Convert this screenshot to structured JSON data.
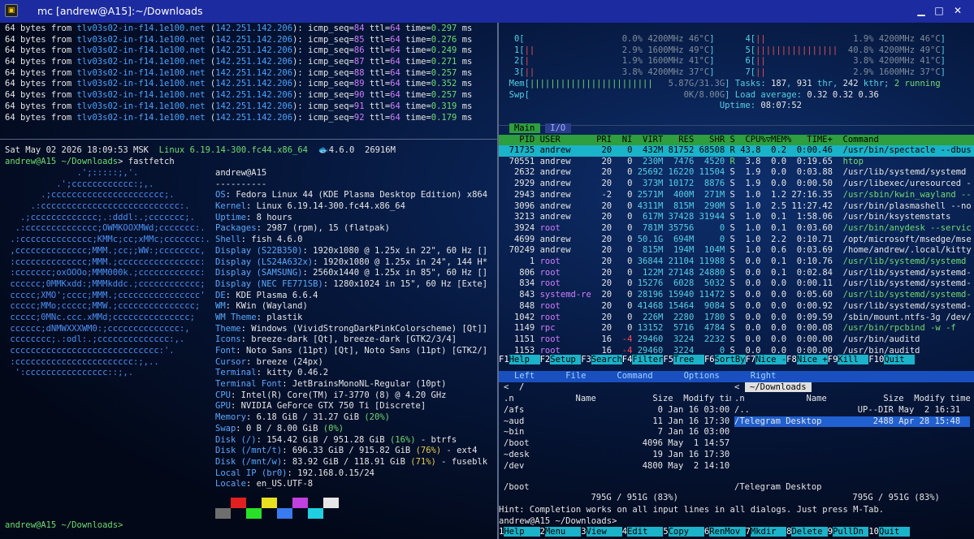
{
  "window": {
    "title": "mc [andrew@A15]:~/Downloads"
  },
  "ping": [
    {
      "seq": "84",
      "time": "0.297"
    },
    {
      "seq": "85",
      "time": "0.276"
    },
    {
      "seq": "86",
      "time": "0.249"
    },
    {
      "seq": "87",
      "time": "0.271"
    },
    {
      "seq": "88",
      "time": "0.257"
    },
    {
      "seq": "89",
      "time": "0.352"
    },
    {
      "seq": "90",
      "time": "0.257"
    },
    {
      "seq": "91",
      "time": "0.319"
    },
    {
      "seq": "92",
      "time": "0.179"
    }
  ],
  "ping_host": "tlv03s02-in-f14.1e100.net",
  "ping_ip": "142.251.142.206",
  "status": {
    "date": "Sat May 02 2026 18:09:53 MSK",
    "kernel": "Linux 6.19.14-300.fc44.x86_64",
    "shell_ver": "4.6.0",
    "mem": "26916M"
  },
  "prompt": {
    "user": "andrew@A15",
    "dir": "~/Downloads",
    "cmd": "fastfetch"
  },
  "logo": [
    "              .';:::::;,'.",
    "          .';cccccccccccc:;,.",
    "       .;cccccccccccccccccccccc;.",
    "     .:ccccccccccccccccccccccccccc:.",
    "   .;ccccccccccccc;.:dddl:.;ccccccc;.",
    "  .:cccccccccccccc;OWMKOOXMWd;ccccccc:.",
    " .:cccccccccccccc;KMMc;cc;xMMc;ccccccc:.",
    " ,cccccccccccccc;MMM.;cc;;WW:;cccccccc,",
    " :cccccccccccccc;MMM.;cccccccccccccccc:",
    " :ccccccc;oxOOOo;MMM000k.;cccccccccccc:",
    " cccccc;0MMKxdd:;MMMkddc.;cccccccccccc;",
    " ccccc;XMO';cccc;MMM.;cccccccccccccccc'",
    " ccccc;MMo;ccccc;MMW.;ccccccccccccccc;",
    " ccccc;0MNc.ccc.xMMd;ccccccccccccccc;",
    " cccccc;dNMWXXXWM0:;cccccccccccccc:,",
    " cccccccc;.:odl:.;cccccccccccccc:,.",
    " ccccccccccccccccccccccccccccc:'.",
    " :ccccccccccccccccccccccc:;,..",
    "  ':cccccccccccccccc::;,."
  ],
  "ff_user": "andrew@A15",
  "ff_sep": "----------",
  "ff": [
    {
      "k": "OS",
      "v": "Fedora Linux 44 (KDE Plasma Desktop Edition) x864"
    },
    {
      "k": "Kernel",
      "v": "Linux 6.19.14-300.fc44.x86_64"
    },
    {
      "k": "Uptime",
      "v": "8 hours"
    },
    {
      "k": "Packages",
      "v": "2987 (rpm), 15 (flatpak)"
    },
    {
      "k": "Shell",
      "v": "fish 4.6.0"
    },
    {
      "k": "Display (S22B350)",
      "v": "1920x1080 @ 1.25x in 22\", 60 Hz []"
    },
    {
      "k": "Display (LS24A632x)",
      "v": "1920x1080 @ 1.25x in 24\", 144 H*"
    },
    {
      "k": "Display (SAMSUNG)",
      "v": "2560x1440 @ 1.25x in 85\", 60 Hz []"
    },
    {
      "k": "Display (NEC FE771SB)",
      "v": "1280x1024 in 15\", 60 Hz [Exte]"
    },
    {
      "k": "DE",
      "v": "KDE Plasma 6.6.4"
    },
    {
      "k": "WM",
      "v": "KWin (Wayland)"
    },
    {
      "k": "WM Theme",
      "v": "plastik"
    },
    {
      "k": "Theme",
      "v": "Windows (VividStrongDarkPinkColorscheme) [Qt]]"
    },
    {
      "k": "Icons",
      "v": "breeze-dark [Qt], breeze-dark [GTK2/3/4]"
    },
    {
      "k": "Font",
      "v": "Noto Sans (11pt) [Qt], Noto Sans (11pt) [GTK2/]"
    },
    {
      "k": "Cursor",
      "v": "breeze (24px)"
    },
    {
      "k": "Terminal",
      "v": "kitty 0.46.2"
    },
    {
      "k": "Terminal Font",
      "v": "JetBrainsMonoNL-Regular (10pt)"
    },
    {
      "k": "CPU",
      "v": "Intel(R) Core(TM) i7-3770 (8) @ 4.20 GHz"
    },
    {
      "k": "GPU",
      "v": "NVIDIA GeForce GTX 750 Ti [Discrete]"
    },
    {
      "k": "Memory",
      "v": "6.18 GiB / 31.27 GiB",
      "p": "(20%)",
      "pc": "g"
    },
    {
      "k": "Swap",
      "v": "0 B / 8.00 GiB",
      "p": "(0%)",
      "pc": "g"
    },
    {
      "k": "Disk (/)",
      "v": "154.42 GiB / 951.28 GiB",
      "p": "(16%)",
      "pc": "g",
      "t": " - btrfs"
    },
    {
      "k": "Disk (/mnt/t)",
      "v": "696.33 GiB / 915.82 GiB",
      "p": "(76%)",
      "pc": "y",
      "t": " - ext4"
    },
    {
      "k": "Disk (/mnt/w)",
      "v": "83.92 GiB / 118.91 GiB",
      "p": "(71%)",
      "pc": "y",
      "t": " - fuseblk"
    },
    {
      "k": "Local IP (br0)",
      "v": "192.168.0.15/24"
    },
    {
      "k": "Locale",
      "v": "en_US.UTF-8"
    }
  ],
  "swatches": [
    "#6e6e6e",
    "#e02020",
    "#28e028",
    "#e8e020",
    "#3a7af0",
    "#c040e0",
    "#20d0e0",
    "#e6e6e6"
  ],
  "prompt2": "andrew@A15 ~/Downloads>",
  "htop": {
    "cpus": [
      {
        "n": "0",
        "pct": "0.0%",
        "mhz": "4200MHz",
        "t": "46°C",
        "bars": ""
      },
      {
        "n": "1",
        "pct": "2.9%",
        "mhz": "1600MHz",
        "t": "49°C",
        "bars": "||"
      },
      {
        "n": "2",
        "pct": "1.9%",
        "mhz": "1600MHz",
        "t": "41°C",
        "bars": "|"
      },
      {
        "n": "3",
        "pct": "3.8%",
        "mhz": "4200MHz",
        "t": "37°C",
        "bars": "||"
      },
      {
        "n": "4",
        "pct": "1.9%",
        "mhz": "4200MHz",
        "t": "46°C",
        "bars": "||"
      },
      {
        "n": "5",
        "pct": "40.8%",
        "mhz": "4200MHz",
        "t": "49°C",
        "bars": "||||||||||||||||"
      },
      {
        "n": "6",
        "pct": "3.8%",
        "mhz": "4200MHz",
        "t": "41°C",
        "bars": "||"
      },
      {
        "n": "7",
        "pct": "2.9%",
        "mhz": "1600MHz",
        "t": "37°C",
        "bars": "||"
      }
    ],
    "mem_bars": "||||||||||||||||||||||||",
    "mem": "5.87G/31.3G",
    "swp": "0K/8.00G",
    "tasks": "187",
    "thr": "931",
    "kthr": "242",
    "running": "2",
    "load": [
      "0.32",
      "0.32",
      "0.36"
    ],
    "uptime": "08:07:52",
    "tabs": [
      "Main",
      "I/O"
    ],
    "header": "    PID USER       PRI  NI  VIRT   RES   SHR S  CPU%▽MEM%   TIME+  Command",
    "procs": [
      [
        "71735",
        "andrew",
        "20",
        "0",
        "432M",
        "81752",
        "68508",
        "R",
        "43.8",
        "0.2",
        "0:00.46",
        "/usr/bin/spectacle --dbus"
      ],
      [
        "70551",
        "andrew",
        "20",
        "0",
        "230M",
        "7476",
        "4520",
        "R",
        "3.8",
        "0.0",
        "0:19.65",
        "htop"
      ],
      [
        "2632",
        "andrew",
        "20",
        "0",
        "25692",
        "16220",
        "11504",
        "S",
        "1.9",
        "0.0",
        "0:03.88",
        "/usr/lib/systemd/systemd"
      ],
      [
        "2929",
        "andrew",
        "20",
        "0",
        "373M",
        "10172",
        "8876",
        "S",
        "1.9",
        "0.0",
        "0:00.50",
        "/usr/libexec/uresourced -"
      ],
      [
        "2943",
        "andrew",
        "-2",
        "0",
        "2571M",
        "400M",
        "271M",
        "S",
        "1.0",
        "1.2",
        "27:16.35",
        "/usr/sbin/kwin_wayland --"
      ],
      [
        "3096",
        "andrew",
        "20",
        "0",
        "4311M",
        "815M",
        "290M",
        "S",
        "1.0",
        "2.5",
        "11:27.42",
        "/usr/bin/plasmashell --no"
      ],
      [
        "3213",
        "andrew",
        "20",
        "0",
        "617M",
        "37428",
        "31944",
        "S",
        "1.0",
        "0.1",
        "1:58.06",
        "/usr/bin/ksystemstats"
      ],
      [
        "3924",
        "root",
        "20",
        "0",
        "781M",
        "35756",
        "0",
        "S",
        "1.0",
        "0.1",
        "0:03.60",
        "/usr/bin/anydesk --servic"
      ],
      [
        "4699",
        "andrew",
        "20",
        "0",
        "50.1G",
        "694M",
        "0",
        "S",
        "1.0",
        "2.2",
        "0:10.71",
        "/opt/microsoft/msedge/mse"
      ],
      [
        "70249",
        "andrew",
        "20",
        "0",
        "815M",
        "194M",
        "104M",
        "S",
        "1.0",
        "0.6",
        "0:03.69",
        "/home/andrew/.local/kitty"
      ],
      [
        "1",
        "root",
        "20",
        "0",
        "36844",
        "21104",
        "11988",
        "S",
        "0.0",
        "0.1",
        "0:10.76",
        "/usr/lib/systemd/systemd"
      ],
      [
        "806",
        "root",
        "20",
        "0",
        "122M",
        "27148",
        "24880",
        "S",
        "0.0",
        "0.1",
        "0:02.84",
        "/usr/lib/systemd/systemd-"
      ],
      [
        "834",
        "root",
        "20",
        "0",
        "15276",
        "6028",
        "5032",
        "S",
        "0.0",
        "0.0",
        "0:00.11",
        "/usr/lib/systemd/systemd-"
      ],
      [
        "843",
        "systemd-re",
        "20",
        "0",
        "28196",
        "15940",
        "11472",
        "S",
        "0.0",
        "0.0",
        "0:05.60",
        "/usr/lib/systemd/systemd-"
      ],
      [
        "848",
        "root",
        "20",
        "0",
        "41468",
        "15464",
        "9084",
        "S",
        "0.0",
        "0.0",
        "0:00.92",
        "/usr/lib/systemd/systemd-"
      ],
      [
        "1042",
        "root",
        "20",
        "0",
        "226M",
        "2280",
        "1780",
        "S",
        "0.0",
        "0.0",
        "0:09.59",
        "/sbin/mount.ntfs-3g /dev/"
      ],
      [
        "1149",
        "rpc",
        "20",
        "0",
        "13152",
        "5716",
        "4784",
        "S",
        "0.0",
        "0.0",
        "0:00.08",
        "/usr/bin/rpcbind -w -f"
      ],
      [
        "1151",
        "root",
        "16",
        "-4",
        "29460",
        "3224",
        "2232",
        "S",
        "0.0",
        "0.0",
        "0:00.00",
        "/usr/bin/auditd"
      ],
      [
        "1153",
        "root",
        "16",
        "-4",
        "29460",
        "3224",
        "0",
        "S",
        "0.0",
        "0.0",
        "0:00.00",
        "/usr/bin/auditd"
      ]
    ],
    "fkeys": [
      [
        "F1",
        "Help"
      ],
      [
        "F2",
        "Setup"
      ],
      [
        "F3",
        "Search"
      ],
      [
        "F4",
        "Filter"
      ],
      [
        "F5",
        "Tree"
      ],
      [
        "F6",
        "SortBy"
      ],
      [
        "F7",
        "Nice -"
      ],
      [
        "F8",
        "Nice +"
      ],
      [
        "F9",
        "Kill"
      ],
      [
        "F10",
        "Quit"
      ]
    ]
  },
  "mc": {
    "menu": [
      "Left",
      "File",
      "Command",
      "Options",
      "Right"
    ],
    "left": {
      "path": "/",
      "cols": [
        "n",
        "Name",
        "Size",
        "Modify time"
      ],
      "rows": [
        [
          "/afs",
          "0",
          "Jan 16 03:00"
        ],
        [
          "~aud",
          "11",
          "Jan 16 17:30"
        ],
        [
          "~bin",
          "7",
          "Jan 16 03:00"
        ],
        [
          "/boot",
          "4096",
          "May  1 14:57"
        ],
        [
          "~desk",
          "19",
          "Jan 16 17:30"
        ],
        [
          "/dev",
          "4800",
          "May  2 14:10"
        ]
      ],
      "status": "/boot",
      "free": "795G / 951G (83%)"
    },
    "right": {
      "path": "~/Downloads",
      "cols": [
        "n",
        "Name",
        "Size",
        "Modify time"
      ],
      "rows": [
        [
          "/..",
          "UP--DIR",
          "May  2 16:31"
        ],
        [
          "/Telegram Desktop",
          "2488",
          "Apr 28 15:48"
        ]
      ],
      "status": "/Telegram Desktop",
      "free": "795G / 951G (83%)"
    },
    "hint": "Hint: Completion works on all input lines in all dialogs. Just press M-Tab.",
    "prompt": "andrew@A15 ~/Downloads>",
    "fkeys": [
      [
        "1",
        "Help"
      ],
      [
        "2",
        "Menu"
      ],
      [
        "3",
        "View"
      ],
      [
        "4",
        "Edit"
      ],
      [
        "5",
        "Copy"
      ],
      [
        "6",
        "RenMov"
      ],
      [
        "7",
        "Mkdir"
      ],
      [
        "8",
        "Delete"
      ],
      [
        "9",
        "PullDn"
      ],
      [
        "10",
        "Quit"
      ]
    ]
  }
}
